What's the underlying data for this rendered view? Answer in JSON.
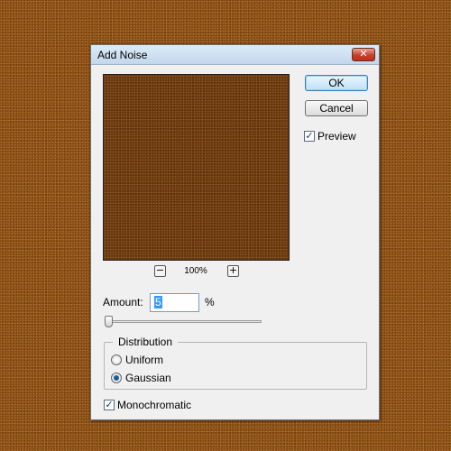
{
  "dialog": {
    "title": "Add Noise",
    "close_glyph": "✕"
  },
  "preview": {
    "zoom_out_glyph": "−",
    "zoom_in_glyph": "+",
    "zoom_level": "100%"
  },
  "buttons": {
    "ok": "OK",
    "cancel": "Cancel"
  },
  "preview_checkbox": {
    "label": "Preview",
    "checked": true,
    "check_glyph": "✓"
  },
  "amount": {
    "label": "Amount:",
    "value": "5",
    "unit": "%",
    "slider_min": 0.1,
    "slider_max": 400,
    "slider_value": 5
  },
  "distribution": {
    "label": "Distribution",
    "options": [
      {
        "label": "Uniform",
        "selected": false
      },
      {
        "label": "Gaussian",
        "selected": true
      }
    ]
  },
  "monochromatic": {
    "label": "Monochromatic",
    "checked": true,
    "check_glyph": "✓"
  },
  "colors": {
    "canvas_brown": "#8a4e14",
    "dialog_bg": "#f0f0f0",
    "ok_accent": "#3c7fb1"
  }
}
